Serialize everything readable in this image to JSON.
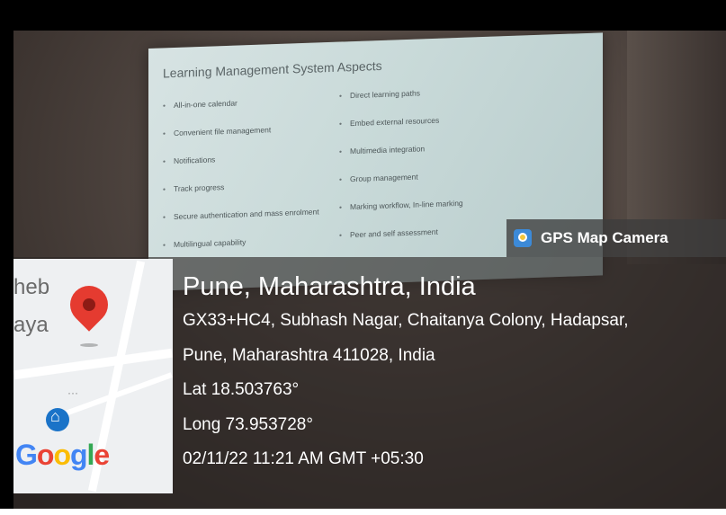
{
  "slide": {
    "title": "Learning Management System Aspects",
    "left_bullets": [
      "All-in-one calendar",
      "Convenient file management",
      "Notifications",
      "Track progress",
      "Secure authentication and mass enrolment",
      "Multilingual capability"
    ],
    "right_bullets": [
      "Direct learning paths",
      "Embed external resources",
      "Multimedia integration",
      "Group management",
      "Marking workflow, In-line marking",
      "Peer and self assessment"
    ]
  },
  "badge": {
    "label": "GPS Map Camera",
    "icon": "gps-map-camera-icon"
  },
  "map": {
    "label_top": "heb",
    "label_mid": "aya",
    "pin_icon": "map-pin-icon",
    "logo": [
      "G",
      "o",
      "o",
      "g",
      "l",
      "e"
    ]
  },
  "location": {
    "title": "Pune, Maharashtra, India",
    "address_line1": "GX33+HC4, Subhash Nagar, Chaitanya Colony, Hadapsar,",
    "address_line2": "Pune, Maharashtra 411028, India",
    "lat": "Lat 18.503763°",
    "long": "Long 73.953728°",
    "datetime": "02/11/22 11:21 AM GMT +05:30"
  },
  "colors": {
    "pin": "#e53b30",
    "badge_bg": "#3c3c3c",
    "text": "#ffffff"
  }
}
